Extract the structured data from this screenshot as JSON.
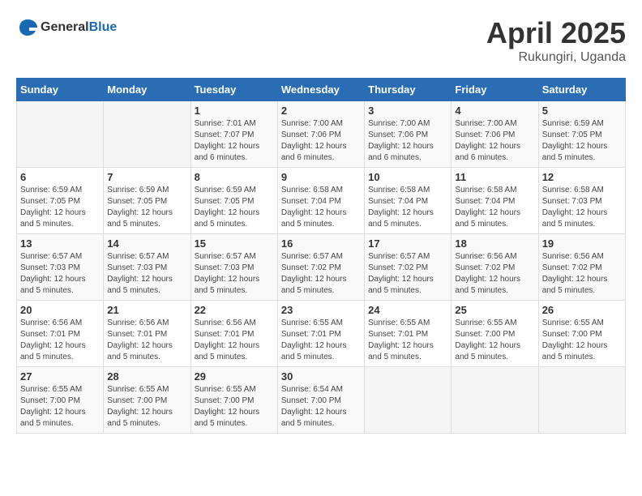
{
  "header": {
    "logo_general": "General",
    "logo_blue": "Blue",
    "month_year": "April 2025",
    "location": "Rukungiri, Uganda"
  },
  "days_of_week": [
    "Sunday",
    "Monday",
    "Tuesday",
    "Wednesday",
    "Thursday",
    "Friday",
    "Saturday"
  ],
  "weeks": [
    [
      {
        "day": "",
        "sunrise": "",
        "sunset": "",
        "daylight": ""
      },
      {
        "day": "",
        "sunrise": "",
        "sunset": "",
        "daylight": ""
      },
      {
        "day": "1",
        "sunrise": "Sunrise: 7:01 AM",
        "sunset": "Sunset: 7:07 PM",
        "daylight": "Daylight: 12 hours and 6 minutes."
      },
      {
        "day": "2",
        "sunrise": "Sunrise: 7:00 AM",
        "sunset": "Sunset: 7:06 PM",
        "daylight": "Daylight: 12 hours and 6 minutes."
      },
      {
        "day": "3",
        "sunrise": "Sunrise: 7:00 AM",
        "sunset": "Sunset: 7:06 PM",
        "daylight": "Daylight: 12 hours and 6 minutes."
      },
      {
        "day": "4",
        "sunrise": "Sunrise: 7:00 AM",
        "sunset": "Sunset: 7:06 PM",
        "daylight": "Daylight: 12 hours and 6 minutes."
      },
      {
        "day": "5",
        "sunrise": "Sunrise: 6:59 AM",
        "sunset": "Sunset: 7:05 PM",
        "daylight": "Daylight: 12 hours and 5 minutes."
      }
    ],
    [
      {
        "day": "6",
        "sunrise": "Sunrise: 6:59 AM",
        "sunset": "Sunset: 7:05 PM",
        "daylight": "Daylight: 12 hours and 5 minutes."
      },
      {
        "day": "7",
        "sunrise": "Sunrise: 6:59 AM",
        "sunset": "Sunset: 7:05 PM",
        "daylight": "Daylight: 12 hours and 5 minutes."
      },
      {
        "day": "8",
        "sunrise": "Sunrise: 6:59 AM",
        "sunset": "Sunset: 7:05 PM",
        "daylight": "Daylight: 12 hours and 5 minutes."
      },
      {
        "day": "9",
        "sunrise": "Sunrise: 6:58 AM",
        "sunset": "Sunset: 7:04 PM",
        "daylight": "Daylight: 12 hours and 5 minutes."
      },
      {
        "day": "10",
        "sunrise": "Sunrise: 6:58 AM",
        "sunset": "Sunset: 7:04 PM",
        "daylight": "Daylight: 12 hours and 5 minutes."
      },
      {
        "day": "11",
        "sunrise": "Sunrise: 6:58 AM",
        "sunset": "Sunset: 7:04 PM",
        "daylight": "Daylight: 12 hours and 5 minutes."
      },
      {
        "day": "12",
        "sunrise": "Sunrise: 6:58 AM",
        "sunset": "Sunset: 7:03 PM",
        "daylight": "Daylight: 12 hours and 5 minutes."
      }
    ],
    [
      {
        "day": "13",
        "sunrise": "Sunrise: 6:57 AM",
        "sunset": "Sunset: 7:03 PM",
        "daylight": "Daylight: 12 hours and 5 minutes."
      },
      {
        "day": "14",
        "sunrise": "Sunrise: 6:57 AM",
        "sunset": "Sunset: 7:03 PM",
        "daylight": "Daylight: 12 hours and 5 minutes."
      },
      {
        "day": "15",
        "sunrise": "Sunrise: 6:57 AM",
        "sunset": "Sunset: 7:03 PM",
        "daylight": "Daylight: 12 hours and 5 minutes."
      },
      {
        "day": "16",
        "sunrise": "Sunrise: 6:57 AM",
        "sunset": "Sunset: 7:02 PM",
        "daylight": "Daylight: 12 hours and 5 minutes."
      },
      {
        "day": "17",
        "sunrise": "Sunrise: 6:57 AM",
        "sunset": "Sunset: 7:02 PM",
        "daylight": "Daylight: 12 hours and 5 minutes."
      },
      {
        "day": "18",
        "sunrise": "Sunrise: 6:56 AM",
        "sunset": "Sunset: 7:02 PM",
        "daylight": "Daylight: 12 hours and 5 minutes."
      },
      {
        "day": "19",
        "sunrise": "Sunrise: 6:56 AM",
        "sunset": "Sunset: 7:02 PM",
        "daylight": "Daylight: 12 hours and 5 minutes."
      }
    ],
    [
      {
        "day": "20",
        "sunrise": "Sunrise: 6:56 AM",
        "sunset": "Sunset: 7:01 PM",
        "daylight": "Daylight: 12 hours and 5 minutes."
      },
      {
        "day": "21",
        "sunrise": "Sunrise: 6:56 AM",
        "sunset": "Sunset: 7:01 PM",
        "daylight": "Daylight: 12 hours and 5 minutes."
      },
      {
        "day": "22",
        "sunrise": "Sunrise: 6:56 AM",
        "sunset": "Sunset: 7:01 PM",
        "daylight": "Daylight: 12 hours and 5 minutes."
      },
      {
        "day": "23",
        "sunrise": "Sunrise: 6:55 AM",
        "sunset": "Sunset: 7:01 PM",
        "daylight": "Daylight: 12 hours and 5 minutes."
      },
      {
        "day": "24",
        "sunrise": "Sunrise: 6:55 AM",
        "sunset": "Sunset: 7:01 PM",
        "daylight": "Daylight: 12 hours and 5 minutes."
      },
      {
        "day": "25",
        "sunrise": "Sunrise: 6:55 AM",
        "sunset": "Sunset: 7:00 PM",
        "daylight": "Daylight: 12 hours and 5 minutes."
      },
      {
        "day": "26",
        "sunrise": "Sunrise: 6:55 AM",
        "sunset": "Sunset: 7:00 PM",
        "daylight": "Daylight: 12 hours and 5 minutes."
      }
    ],
    [
      {
        "day": "27",
        "sunrise": "Sunrise: 6:55 AM",
        "sunset": "Sunset: 7:00 PM",
        "daylight": "Daylight: 12 hours and 5 minutes."
      },
      {
        "day": "28",
        "sunrise": "Sunrise: 6:55 AM",
        "sunset": "Sunset: 7:00 PM",
        "daylight": "Daylight: 12 hours and 5 minutes."
      },
      {
        "day": "29",
        "sunrise": "Sunrise: 6:55 AM",
        "sunset": "Sunset: 7:00 PM",
        "daylight": "Daylight: 12 hours and 5 minutes."
      },
      {
        "day": "30",
        "sunrise": "Sunrise: 6:54 AM",
        "sunset": "Sunset: 7:00 PM",
        "daylight": "Daylight: 12 hours and 5 minutes."
      },
      {
        "day": "",
        "sunrise": "",
        "sunset": "",
        "daylight": ""
      },
      {
        "day": "",
        "sunrise": "",
        "sunset": "",
        "daylight": ""
      },
      {
        "day": "",
        "sunrise": "",
        "sunset": "",
        "daylight": ""
      }
    ]
  ]
}
